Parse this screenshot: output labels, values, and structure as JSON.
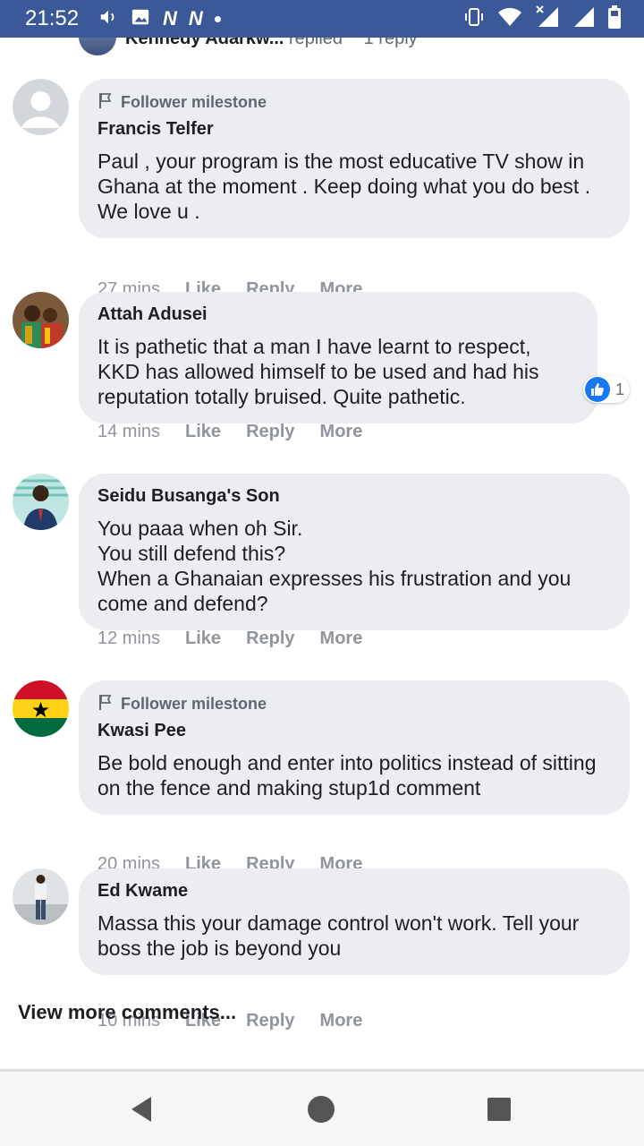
{
  "status_bar": {
    "time": "21:52",
    "left_icons": [
      "volume-icon",
      "image-icon",
      "nn-app-icon",
      "nn-app-icon",
      "notification-dot-icon"
    ],
    "nn_label": "N",
    "right_icons": [
      "vibrate-icon",
      "wifi-icon",
      "signal-x-icon",
      "signal-icon",
      "battery-icon"
    ],
    "bar_color": "#3b5998"
  },
  "partial_reply": {
    "name": "Kennedy Adarkw...",
    "verb": "replied",
    "count": "1 reply"
  },
  "comments": [
    {
      "milestone": "Follower milestone",
      "author": "Francis Telfer",
      "text": "Paul , your program is the most educative TV show in Ghana at the moment . Keep doing what you do best . We love u .",
      "time": "27 mins",
      "like": "Like",
      "reply": "Reply",
      "more": "More",
      "avatar": "default-avatar-icon"
    },
    {
      "author": "Attah Adusei",
      "text": "It is pathetic that a man I have learnt to respect, KKD has allowed himself to be used and had his reputation totally bruised. Quite pathetic.",
      "time": "14 mins",
      "like": "Like",
      "reply": "Reply",
      "more": "More",
      "reaction_count": "1",
      "avatar": "photo-avatar"
    },
    {
      "author": "Seidu Busanga's Son",
      "text": "You paaa when oh Sir.\nYou still defend this?\nWhen a Ghanaian expresses his frustration and you come and defend?",
      "time": "12 mins",
      "like": "Like",
      "reply": "Reply",
      "more": "More",
      "avatar": "photo-avatar"
    },
    {
      "milestone": "Follower milestone",
      "author": "Kwasi Pee",
      "text": "Be bold enough and enter into politics instead of sitting on the fence and making stup1d comment",
      "time": "20 mins",
      "like": "Like",
      "reply": "Reply",
      "more": "More",
      "avatar": "ghana-flag-avatar"
    },
    {
      "author": "Ed Kwame",
      "text": "Massa this your damage control won't work. Tell your boss the job is beyond you",
      "time": "10 mins",
      "like": "Like",
      "reply": "Reply",
      "more": "More",
      "avatar": "photo-avatar"
    }
  ],
  "view_more": "View more comments...",
  "nav": [
    "back-icon",
    "home-icon",
    "recents-icon"
  ],
  "colors": {
    "bubble": "#ebedf0",
    "action_text": "#90949c",
    "like_blue": "#1877f2"
  }
}
